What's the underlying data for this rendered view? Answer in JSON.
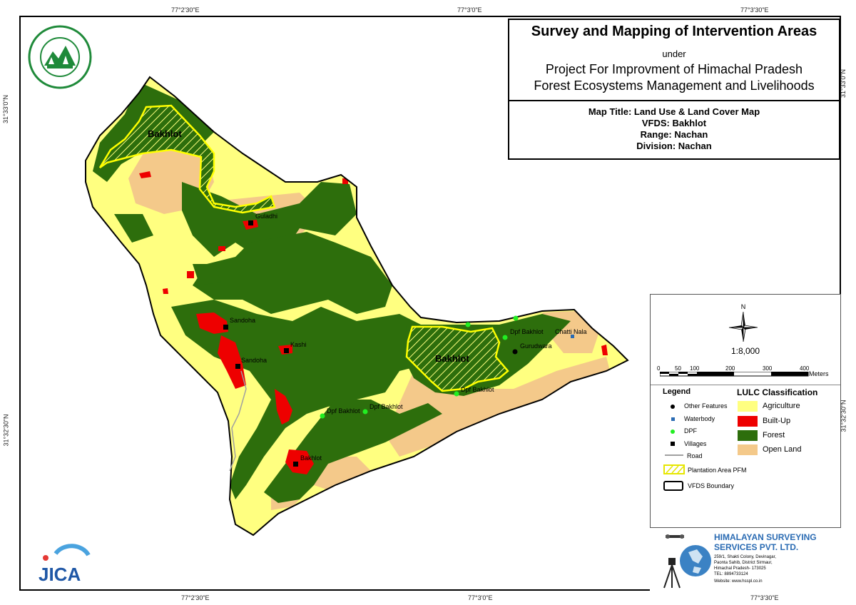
{
  "header": {
    "title": "Survey and Mapping of Intervention Areas",
    "under": "under",
    "project_line1": "Project For Improvment of Himachal Pradesh",
    "project_line2": "Forest Ecosystems Management and Livelihoods"
  },
  "map_info": {
    "map_title": "Map Title: Land Use & Land Cover Map",
    "vfds": "VFDS: Bakhlot",
    "range": "Range: Nachan",
    "division": "Division: Nachan"
  },
  "coordinates": {
    "top": [
      "77°2'30\"E",
      "77°3'0\"E",
      "77°3'30\"E"
    ],
    "bottom": [
      "77°2'30\"E",
      "77°3'0\"E",
      "77°3'30\"E"
    ],
    "left": [
      "31°33'0\"N",
      "31°32'30\"N"
    ],
    "right": [
      "31°33'0\"N",
      "31°32'30\"N"
    ]
  },
  "north_arrow": {
    "label": "N"
  },
  "scale": {
    "ratio": "1:8,000",
    "ticks": [
      "0",
      "50",
      "100",
      "200",
      "300",
      "400"
    ],
    "unit": "Meters"
  },
  "legend": {
    "title": "Legend",
    "items": {
      "other_features": "Other Features",
      "waterbody": "Waterbody",
      "dpf": "DPF",
      "villages": "Villages",
      "road": "Road",
      "plantation": "Plantation Area PFM",
      "boundary": "VFDS Boundary"
    }
  },
  "lulc": {
    "title": "LULC Classification",
    "classes": [
      {
        "name": "Agriculture",
        "color": "#ffff80"
      },
      {
        "name": "Built-Up",
        "color": "#ee0000"
      },
      {
        "name": "Forest",
        "color": "#2d6e0c"
      },
      {
        "name": "Open Land",
        "color": "#f4c98a"
      }
    ]
  },
  "map_labels": {
    "bakhlot_nw": "Bakhlot",
    "bakhlot_e": "Bakhlot",
    "guladhi": "Guladhi",
    "sandoha1": "Sandoha",
    "sandoha2": "Sandoha",
    "kashi": "Kashi",
    "bakhlot_village": "Bakhlot",
    "dpf1": "Dpf Bakhlot",
    "dpf2": "Dpf Bakhlot",
    "dpf3": "Dpf Bakhlot",
    "dpf4": "Dpf Bakhlot",
    "chatti_nala": "Chatti Nala",
    "gurudwara": "Gurudwara"
  },
  "company": {
    "name_line1": "HIMALAYAN SURVEYING",
    "name_line2": "SERVICES PVT. LTD.",
    "addr1": "259/1, Shakti Colony, Devinagar,",
    "addr2": "Paonta Sahib, District Sirmaur,",
    "addr3": "Himachal Pradesh- 173025",
    "tel": "TEL: 8894733124",
    "web": "Website: www.hsspl.co.in"
  },
  "jica": {
    "text": "JICA"
  },
  "colors": {
    "agriculture": "#ffff80",
    "builtup": "#ee0000",
    "forest": "#2d6e0c",
    "openland": "#f4c98a",
    "plantation": "#ffff00",
    "company_blue": "#2a6bb3"
  }
}
